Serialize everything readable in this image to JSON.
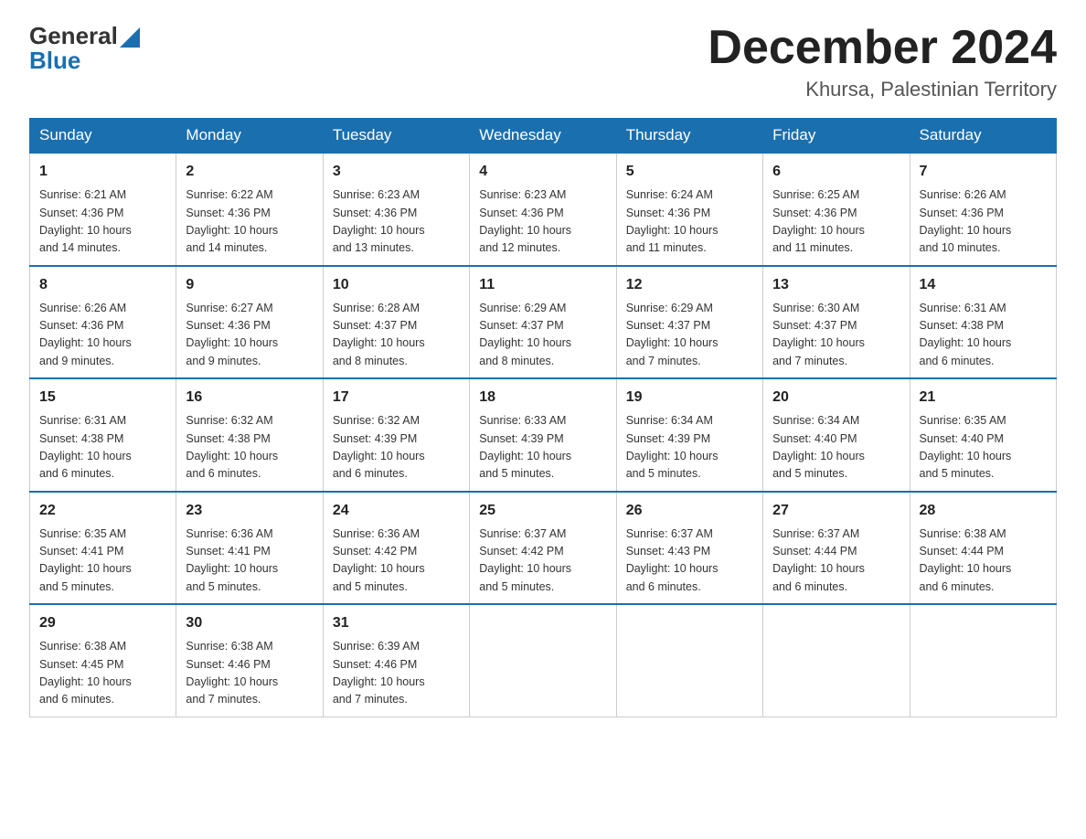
{
  "logo": {
    "general": "General",
    "blue": "Blue"
  },
  "header": {
    "month_year": "December 2024",
    "location": "Khursa, Palestinian Territory"
  },
  "days_of_week": [
    "Sunday",
    "Monday",
    "Tuesday",
    "Wednesday",
    "Thursday",
    "Friday",
    "Saturday"
  ],
  "weeks": [
    [
      {
        "day": "1",
        "sunrise": "6:21 AM",
        "sunset": "4:36 PM",
        "daylight": "10 hours and 14 minutes."
      },
      {
        "day": "2",
        "sunrise": "6:22 AM",
        "sunset": "4:36 PM",
        "daylight": "10 hours and 14 minutes."
      },
      {
        "day": "3",
        "sunrise": "6:23 AM",
        "sunset": "4:36 PM",
        "daylight": "10 hours and 13 minutes."
      },
      {
        "day": "4",
        "sunrise": "6:23 AM",
        "sunset": "4:36 PM",
        "daylight": "10 hours and 12 minutes."
      },
      {
        "day": "5",
        "sunrise": "6:24 AM",
        "sunset": "4:36 PM",
        "daylight": "10 hours and 11 minutes."
      },
      {
        "day": "6",
        "sunrise": "6:25 AM",
        "sunset": "4:36 PM",
        "daylight": "10 hours and 11 minutes."
      },
      {
        "day": "7",
        "sunrise": "6:26 AM",
        "sunset": "4:36 PM",
        "daylight": "10 hours and 10 minutes."
      }
    ],
    [
      {
        "day": "8",
        "sunrise": "6:26 AM",
        "sunset": "4:36 PM",
        "daylight": "10 hours and 9 minutes."
      },
      {
        "day": "9",
        "sunrise": "6:27 AM",
        "sunset": "4:36 PM",
        "daylight": "10 hours and 9 minutes."
      },
      {
        "day": "10",
        "sunrise": "6:28 AM",
        "sunset": "4:37 PM",
        "daylight": "10 hours and 8 minutes."
      },
      {
        "day": "11",
        "sunrise": "6:29 AM",
        "sunset": "4:37 PM",
        "daylight": "10 hours and 8 minutes."
      },
      {
        "day": "12",
        "sunrise": "6:29 AM",
        "sunset": "4:37 PM",
        "daylight": "10 hours and 7 minutes."
      },
      {
        "day": "13",
        "sunrise": "6:30 AM",
        "sunset": "4:37 PM",
        "daylight": "10 hours and 7 minutes."
      },
      {
        "day": "14",
        "sunrise": "6:31 AM",
        "sunset": "4:38 PM",
        "daylight": "10 hours and 6 minutes."
      }
    ],
    [
      {
        "day": "15",
        "sunrise": "6:31 AM",
        "sunset": "4:38 PM",
        "daylight": "10 hours and 6 minutes."
      },
      {
        "day": "16",
        "sunrise": "6:32 AM",
        "sunset": "4:38 PM",
        "daylight": "10 hours and 6 minutes."
      },
      {
        "day": "17",
        "sunrise": "6:32 AM",
        "sunset": "4:39 PM",
        "daylight": "10 hours and 6 minutes."
      },
      {
        "day": "18",
        "sunrise": "6:33 AM",
        "sunset": "4:39 PM",
        "daylight": "10 hours and 5 minutes."
      },
      {
        "day": "19",
        "sunrise": "6:34 AM",
        "sunset": "4:39 PM",
        "daylight": "10 hours and 5 minutes."
      },
      {
        "day": "20",
        "sunrise": "6:34 AM",
        "sunset": "4:40 PM",
        "daylight": "10 hours and 5 minutes."
      },
      {
        "day": "21",
        "sunrise": "6:35 AM",
        "sunset": "4:40 PM",
        "daylight": "10 hours and 5 minutes."
      }
    ],
    [
      {
        "day": "22",
        "sunrise": "6:35 AM",
        "sunset": "4:41 PM",
        "daylight": "10 hours and 5 minutes."
      },
      {
        "day": "23",
        "sunrise": "6:36 AM",
        "sunset": "4:41 PM",
        "daylight": "10 hours and 5 minutes."
      },
      {
        "day": "24",
        "sunrise": "6:36 AM",
        "sunset": "4:42 PM",
        "daylight": "10 hours and 5 minutes."
      },
      {
        "day": "25",
        "sunrise": "6:37 AM",
        "sunset": "4:42 PM",
        "daylight": "10 hours and 5 minutes."
      },
      {
        "day": "26",
        "sunrise": "6:37 AM",
        "sunset": "4:43 PM",
        "daylight": "10 hours and 6 minutes."
      },
      {
        "day": "27",
        "sunrise": "6:37 AM",
        "sunset": "4:44 PM",
        "daylight": "10 hours and 6 minutes."
      },
      {
        "day": "28",
        "sunrise": "6:38 AM",
        "sunset": "4:44 PM",
        "daylight": "10 hours and 6 minutes."
      }
    ],
    [
      {
        "day": "29",
        "sunrise": "6:38 AM",
        "sunset": "4:45 PM",
        "daylight": "10 hours and 6 minutes."
      },
      {
        "day": "30",
        "sunrise": "6:38 AM",
        "sunset": "4:46 PM",
        "daylight": "10 hours and 7 minutes."
      },
      {
        "day": "31",
        "sunrise": "6:39 AM",
        "sunset": "4:46 PM",
        "daylight": "10 hours and 7 minutes."
      },
      null,
      null,
      null,
      null
    ]
  ],
  "labels": {
    "sunrise": "Sunrise:",
    "sunset": "Sunset:",
    "daylight": "Daylight:"
  }
}
